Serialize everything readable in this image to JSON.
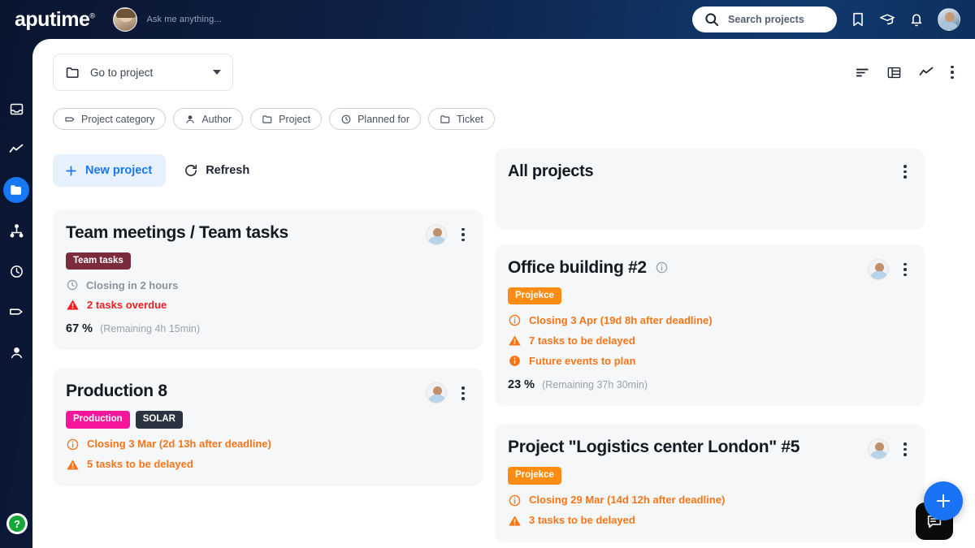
{
  "brand": {
    "name": "aputime",
    "reg": "®",
    "accent": "#1877f2"
  },
  "topbar": {
    "assistant_placeholder": "Ask me anything...",
    "search": {
      "placeholder": "Search projects",
      "icon": "search-icon"
    },
    "icons": [
      {
        "name": "bookmark-icon"
      },
      {
        "name": "graduation-cap-icon"
      },
      {
        "name": "bell-icon"
      }
    ],
    "avatar": "user-avatar"
  },
  "sidebar": {
    "items": [
      {
        "name": "inbox-icon",
        "label": "Inbox",
        "active": false
      },
      {
        "name": "analytics-icon",
        "label": "Analytics",
        "active": false
      },
      {
        "name": "folder-icon",
        "label": "Projects",
        "active": true
      },
      {
        "name": "sitemap-icon",
        "label": "Structure",
        "active": false
      },
      {
        "name": "clock-icon",
        "label": "Time",
        "active": false
      },
      {
        "name": "tag-icon",
        "label": "Tags",
        "active": false
      },
      {
        "name": "person-icon",
        "label": "People",
        "active": false
      }
    ],
    "help_label": "?"
  },
  "toolbar": {
    "goto_project": "Go to project",
    "goto_icon": "folder-icon",
    "view_icons": [
      {
        "name": "sort-lines-icon"
      },
      {
        "name": "table-view-icon"
      },
      {
        "name": "chart-view-icon"
      },
      {
        "name": "more-options-icon"
      }
    ]
  },
  "filters": [
    {
      "label": "Project category",
      "icon": "tag-icon"
    },
    {
      "label": "Author",
      "icon": "person-icon"
    },
    {
      "label": "Project",
      "icon": "folder-icon"
    },
    {
      "label": "Planned for",
      "icon": "clock-icon"
    },
    {
      "label": "Ticket",
      "icon": "folder-icon"
    }
  ],
  "actions": {
    "new_project": "New project",
    "new_project_icon": "plus-icon",
    "refresh": "Refresh",
    "refresh_icon": "refresh-icon"
  },
  "all_projects_card": {
    "title": "All projects",
    "menu_icon": "more-options-icon"
  },
  "projects": [
    {
      "title": "Team meetings / Team tasks",
      "has_info_icon": false,
      "badges": [
        {
          "text": "Team tasks",
          "color": "#7b2b3c"
        }
      ],
      "statuses": [
        {
          "icon": "clock-icon",
          "text": "Closing in 2 hours",
          "tone": "muted"
        },
        {
          "icon": "warning-icon",
          "text": "2 tasks overdue",
          "tone": "red"
        }
      ],
      "percent": "67 %",
      "remaining": "(Remaining 4h 15min)"
    },
    {
      "title": "Office building #2",
      "has_info_icon": true,
      "badges": [
        {
          "text": "Projekce",
          "color": "#ff8c12"
        }
      ],
      "statuses": [
        {
          "icon": "info-circle-icon",
          "text": "Closing 3 Apr (19d 8h after deadline)",
          "tone": "orange"
        },
        {
          "icon": "warning-icon",
          "text": "7 tasks to be delayed",
          "tone": "orange"
        },
        {
          "icon": "info-filled-icon",
          "text": "Future events to plan",
          "tone": "orange"
        }
      ],
      "percent": "23 %",
      "remaining": "(Remaining 37h 30min)"
    },
    {
      "title": "Production 8",
      "has_info_icon": false,
      "badges": [
        {
          "text": "Production",
          "color": "#f5169b"
        },
        {
          "text": "SOLAR",
          "color": "#2b3440"
        }
      ],
      "statuses": [
        {
          "icon": "info-circle-icon",
          "text": "Closing 3 Mar (2d 13h after deadline)",
          "tone": "orange"
        },
        {
          "icon": "warning-icon",
          "text": "5 tasks to be delayed",
          "tone": "orange"
        }
      ],
      "percent": "",
      "remaining": ""
    },
    {
      "title": "Project \"Logistics center London\" #5",
      "has_info_icon": false,
      "badges": [
        {
          "text": "Projekce",
          "color": "#ff8c12"
        }
      ],
      "statuses": [
        {
          "icon": "info-circle-icon",
          "text": "Closing 29 Mar (14d 12h after deadline)",
          "tone": "orange"
        },
        {
          "icon": "warning-icon",
          "text": "3 tasks to be delayed",
          "tone": "orange"
        }
      ],
      "percent": "",
      "remaining": ""
    }
  ],
  "floating": {
    "chat_icon": "chat-bubble-icon",
    "add_icon": "plus-icon"
  }
}
